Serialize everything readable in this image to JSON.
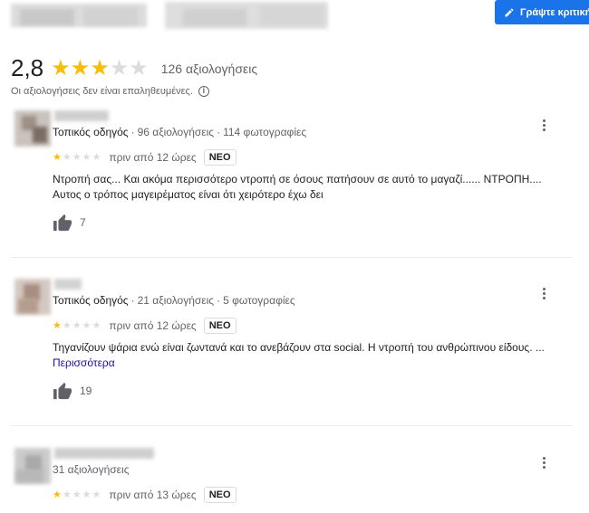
{
  "header": {
    "write_review_label": "Γράψτε κριτική"
  },
  "summary": {
    "rating": "2,8",
    "stars_filled": 3,
    "stars_total": 5,
    "review_count": "126 αξιολογήσεις",
    "unverified_note": "Οι αξιολογήσεις δεν είναι επαληθευμένες."
  },
  "reviews": [
    {
      "guide": "Τοπικός οδηγός",
      "reviews_count": "96 αξιολογήσεις",
      "photos_count": "114 φωτογραφίες",
      "stars": 1,
      "time": "πριν από 12 ώρες",
      "badge": "ΝΕΟ",
      "text": "Ντροπή σας... Και ακόμα περισσότερο ντροπή σε όσους πατήσουν σε αυτό το μαγαζί...... ΝΤΡΟΠΗ.... Αυτος ο τρόπος μαγειρέματος είναι ότι χειρότερο έχω δει",
      "likes": "7"
    },
    {
      "guide": "Τοπικός οδηγός",
      "reviews_count": "21 αξιολογήσεις",
      "photos_count": "5 φωτογραφίες",
      "stars": 1,
      "time": "πριν από 12 ώρες",
      "badge": "ΝΕΟ",
      "text": "Τηγανίζουν ψάρια ενώ είναι ζωντανά και το ανεβάζουν στα social. Η ντροπή του ανθρώπινου είδους. ...",
      "more": "Περισσότερα",
      "likes": "19"
    },
    {
      "reviews_count": "31 αξιολογήσεις",
      "stars": 1,
      "time": "πριν από 13 ώρες",
      "badge": "ΝΕΟ"
    }
  ],
  "colors": {
    "accent": "#1a73e8",
    "star": "#fbbc04",
    "star_empty": "#dadce0",
    "link": "#1a0dab"
  }
}
